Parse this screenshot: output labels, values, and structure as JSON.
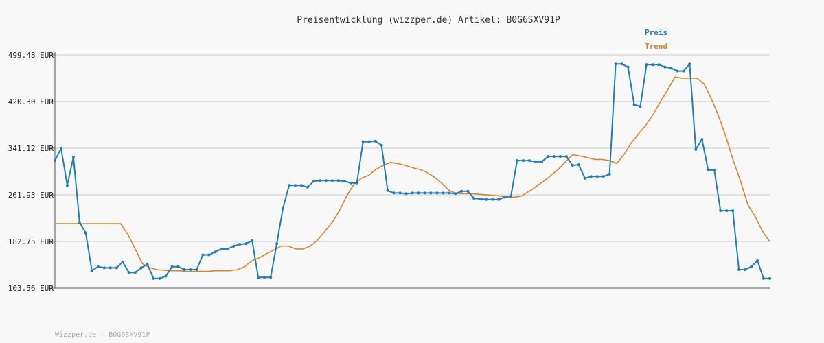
{
  "chart_data": {
    "type": "line",
    "title": "Preisentwicklung (wizzper.de) Artikel: B0G6SXV91P",
    "xlabel": "",
    "ylabel": "",
    "ylim": [
      103.56,
      499.48
    ],
    "y_ticks": [
      "103.56 EUR",
      "182.75 EUR",
      "261.93 EUR",
      "341.12 EUR",
      "420.30 EUR",
      "499.48 EUR"
    ],
    "y_tick_values": [
      103.56,
      182.75,
      261.93,
      341.12,
      420.3,
      499.48
    ],
    "grid": true,
    "legend": "top-right",
    "colors": {
      "preis": "#1e7eb8",
      "trend": "#d9862a"
    },
    "series": [
      {
        "name": "Preis",
        "values": [
          320,
          341,
          278,
          326,
          215,
          197,
          133,
          140,
          138,
          138,
          138,
          148,
          130,
          130,
          138,
          144,
          120,
          120,
          124,
          140,
          140,
          135,
          135,
          135,
          160,
          160,
          165,
          170,
          170,
          175,
          178,
          179,
          184,
          122,
          122,
          122,
          179,
          239,
          278,
          278,
          278,
          275,
          285,
          286,
          286,
          286,
          286,
          285,
          282,
          282,
          352,
          352,
          353,
          346,
          269,
          265,
          265,
          264,
          265,
          265,
          265,
          265,
          265,
          265,
          265,
          264,
          268,
          268,
          256,
          255,
          254,
          254,
          254,
          258,
          260,
          320,
          320,
          320,
          318,
          318,
          327,
          327,
          327,
          327,
          312,
          313,
          290,
          293,
          293,
          293,
          297,
          484,
          484,
          479,
          415,
          412,
          483,
          483,
          483,
          479,
          477,
          472,
          472,
          484,
          339,
          356,
          304,
          304,
          235,
          235,
          235,
          135,
          135,
          140,
          150,
          120,
          120
        ]
      },
      {
        "name": "Trend",
        "values": [
          213,
          213,
          213,
          213,
          213,
          213,
          213,
          213,
          213,
          213,
          195,
          170,
          145,
          138,
          135,
          134,
          133,
          133,
          132,
          132,
          132,
          132,
          133,
          133,
          133,
          135,
          140,
          150,
          155,
          162,
          168,
          175,
          175,
          170,
          170,
          175,
          185,
          200,
          215,
          235,
          260,
          280,
          290,
          295,
          305,
          312,
          317,
          315,
          312,
          308,
          305,
          300,
          292,
          282,
          270,
          264,
          264,
          264,
          263,
          262,
          261,
          260,
          258,
          258,
          260,
          268,
          276,
          285,
          295,
          305,
          318,
          330,
          328,
          325,
          322,
          322,
          320,
          315,
          330,
          350,
          365,
          380,
          398,
          420,
          440,
          462,
          460,
          460,
          460,
          450,
          425,
          395,
          360,
          320,
          285,
          245,
          225,
          200,
          182
        ]
      }
    ],
    "watermark": "Wizzper.de - B0G6SXV91P"
  }
}
